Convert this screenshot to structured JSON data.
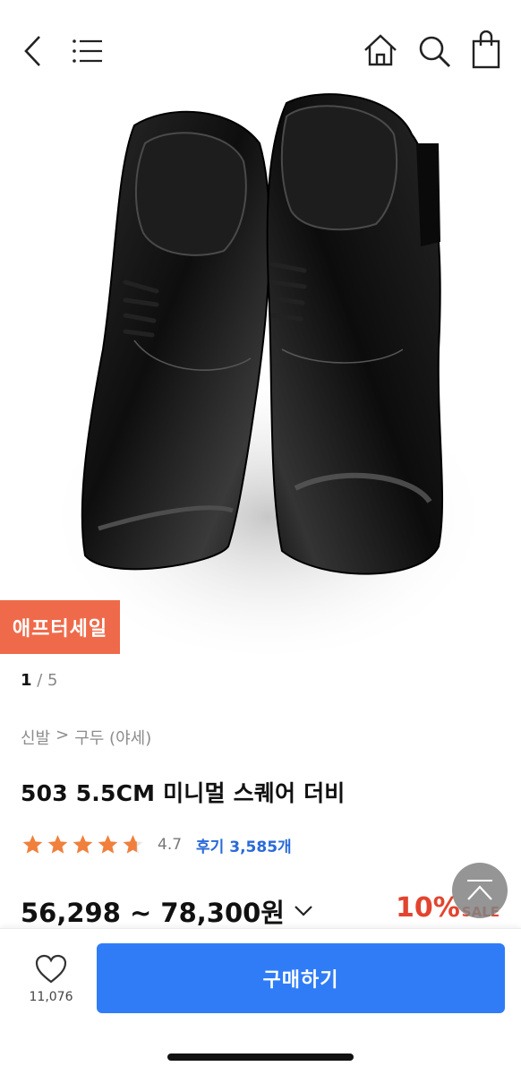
{
  "header": {
    "back_icon": "chevron-left-icon",
    "menu_icon": "hamburger-menu-icon",
    "home_icon": "home-icon",
    "search_icon": "search-icon",
    "cart_icon": "shopping-bag-icon"
  },
  "product": {
    "image_alt": "black square-toe derby shoes",
    "sale_badge": "애프터세일",
    "gallery_current": "1",
    "gallery_sep": " / ",
    "gallery_total": "5",
    "breadcrumb": [
      "신발",
      ">",
      "구두 (야세)"
    ],
    "title": "503 5.5CM 미니멀 스퀘어 더비",
    "rating": 4.7,
    "rating_text": "4.7",
    "review_label": "후기 3,585개",
    "price_range": "56,298 ~ 78,300원",
    "discount_pct": "10%",
    "discount_label": "SALE"
  },
  "colors": {
    "accent": "#2f7cf6",
    "sale": "#ef6a4a",
    "discount": "#e2442f",
    "star": "#f0803c",
    "review": "#2a6ad8"
  },
  "bottom_bar": {
    "wish_icon": "heart-icon",
    "wish_count": "11,076",
    "buy_label": "구매하기"
  },
  "scroll_top_icon": "arrow-up-icon"
}
